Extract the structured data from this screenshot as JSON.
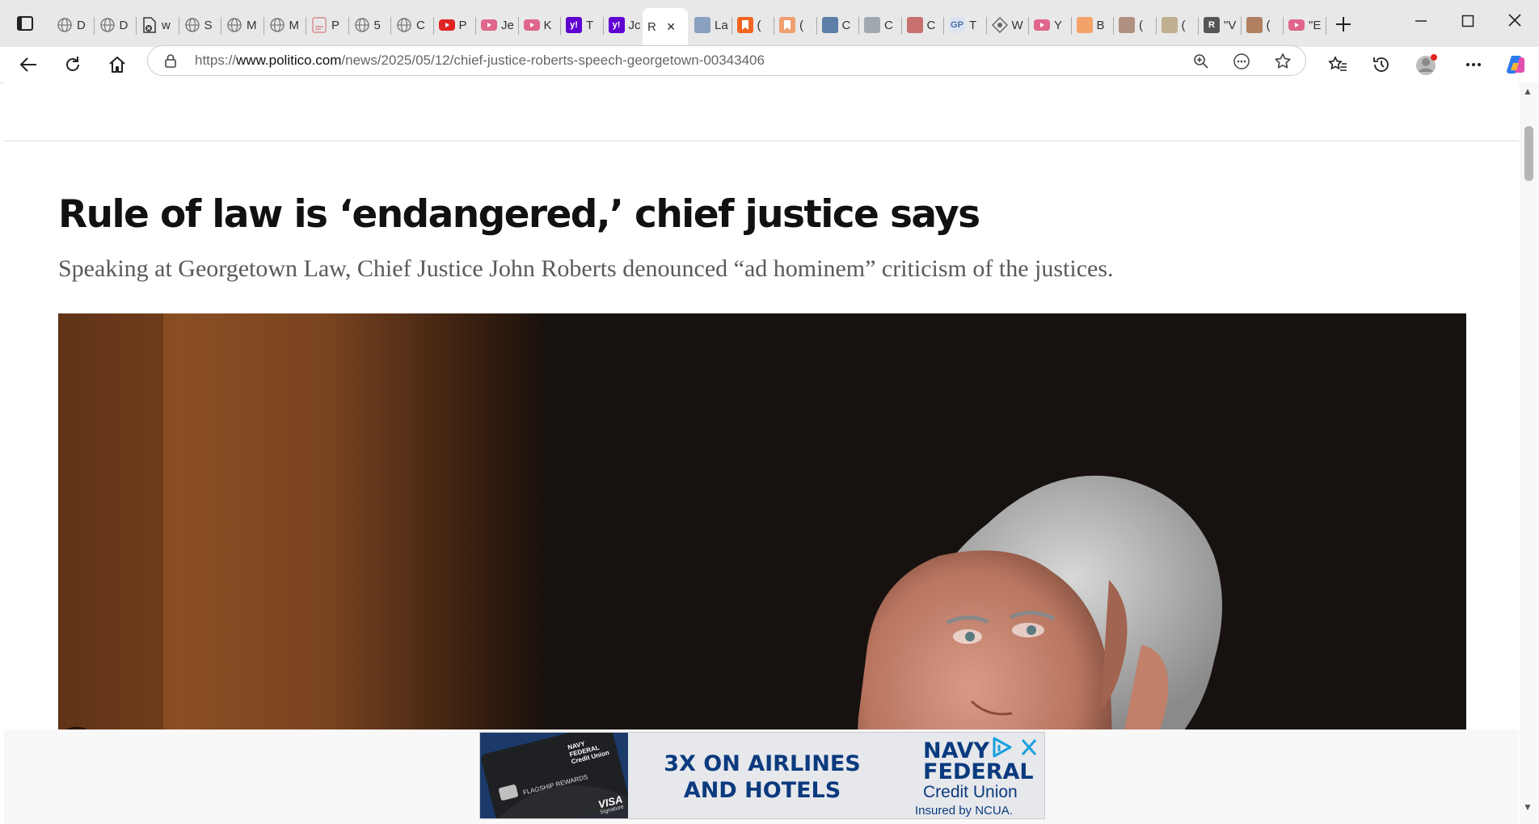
{
  "browser": {
    "tabs": [
      {
        "label": "D",
        "favicon": "globe-icon",
        "color": "#777777"
      },
      {
        "label": "D",
        "favicon": "globe-icon",
        "color": "#777777"
      },
      {
        "label": "w",
        "favicon": "blocked-page-icon",
        "color": "#333333"
      },
      {
        "label": "S",
        "favicon": "globe-icon",
        "color": "#777777"
      },
      {
        "label": "M",
        "favicon": "globe-icon",
        "color": "#777777"
      },
      {
        "label": "M",
        "favicon": "globe-icon",
        "color": "#777777"
      },
      {
        "label": "P",
        "favicon": "pdf-icon",
        "color": "#d88a8a"
      },
      {
        "label": "5",
        "favicon": "globe-icon",
        "color": "#777777"
      },
      {
        "label": "C",
        "favicon": "globe-icon",
        "color": "#777777"
      },
      {
        "label": "P",
        "favicon": "youtube-icon",
        "color": "#e02424"
      },
      {
        "label": "Je",
        "favicon": "youtube-icon",
        "color": "#e0668c"
      },
      {
        "label": "K",
        "favicon": "youtube-icon",
        "color": "#e0668c"
      },
      {
        "label": "T",
        "favicon": "yahoo-icon",
        "color": "#5f01d1"
      },
      {
        "label": "Jc",
        "favicon": "yahoo-icon",
        "color": "#5f01d1"
      },
      {
        "label": "R",
        "favicon": "politico-icon",
        "color": "#d8d8d8",
        "active": true
      },
      {
        "label": "La",
        "favicon": "image-icon",
        "color": "#8aa0c0"
      },
      {
        "label": "(",
        "favicon": "bookmark-icon",
        "color": "#f26522"
      },
      {
        "label": "(",
        "favicon": "bookmark-icon",
        "color": "#f0a070"
      },
      {
        "label": "C",
        "favicon": "square-icon",
        "color": "#5b7fa6"
      },
      {
        "label": "C",
        "favicon": "seal-icon",
        "color": "#a0a8b0"
      },
      {
        "label": "C",
        "favicon": "image-icon",
        "color": "#c87070"
      },
      {
        "label": "T",
        "favicon": "gp-icon",
        "color": "#dde4f0"
      },
      {
        "label": "W",
        "favicon": "diamond-icon",
        "color": "#666666"
      },
      {
        "label": "Y",
        "favicon": "youtube-icon",
        "color": "#e0668c"
      },
      {
        "label": "B",
        "favicon": "blogger-icon",
        "color": "#f5a26a"
      },
      {
        "label": "(",
        "favicon": "image-icon",
        "color": "#b09080"
      },
      {
        "label": "(",
        "favicon": "image-icon",
        "color": "#c0b090"
      },
      {
        "label": "\"V",
        "favicon": "r-icon",
        "color": "#555555"
      },
      {
        "label": "(",
        "favicon": "image-icon",
        "color": "#b08060"
      },
      {
        "label": "\"E",
        "favicon": "youtube-icon",
        "color": "#e0668c"
      }
    ],
    "url_prefix": "https://",
    "url_host": "www.politico.com",
    "url_path": "/news/2025/05/12/chief-justice-roberts-speech-georgetown-00343406",
    "profile_notification_color": "#e0241c"
  },
  "article": {
    "headline": "Rule of law is ‘endangered,’ chief justice says",
    "subheadline": "Speaking at Georgetown Law, Chief Justice John Roberts denounced “ad hominem” criticism of the justices."
  },
  "ad": {
    "headline": "3X ON AIRLINES\nAND HOTELS",
    "brand": "NAVY\nFEDERAL",
    "brand_sub": "Credit Union",
    "note": "Insured by NCUA.",
    "card_brand": "NAVY\nFEDERAL\nCredit Union",
    "card_program": "FLAGSHIP REWARDS",
    "card_network": "VISA",
    "card_network_sub": "Signature",
    "accent_color": "#0b3a7e"
  }
}
